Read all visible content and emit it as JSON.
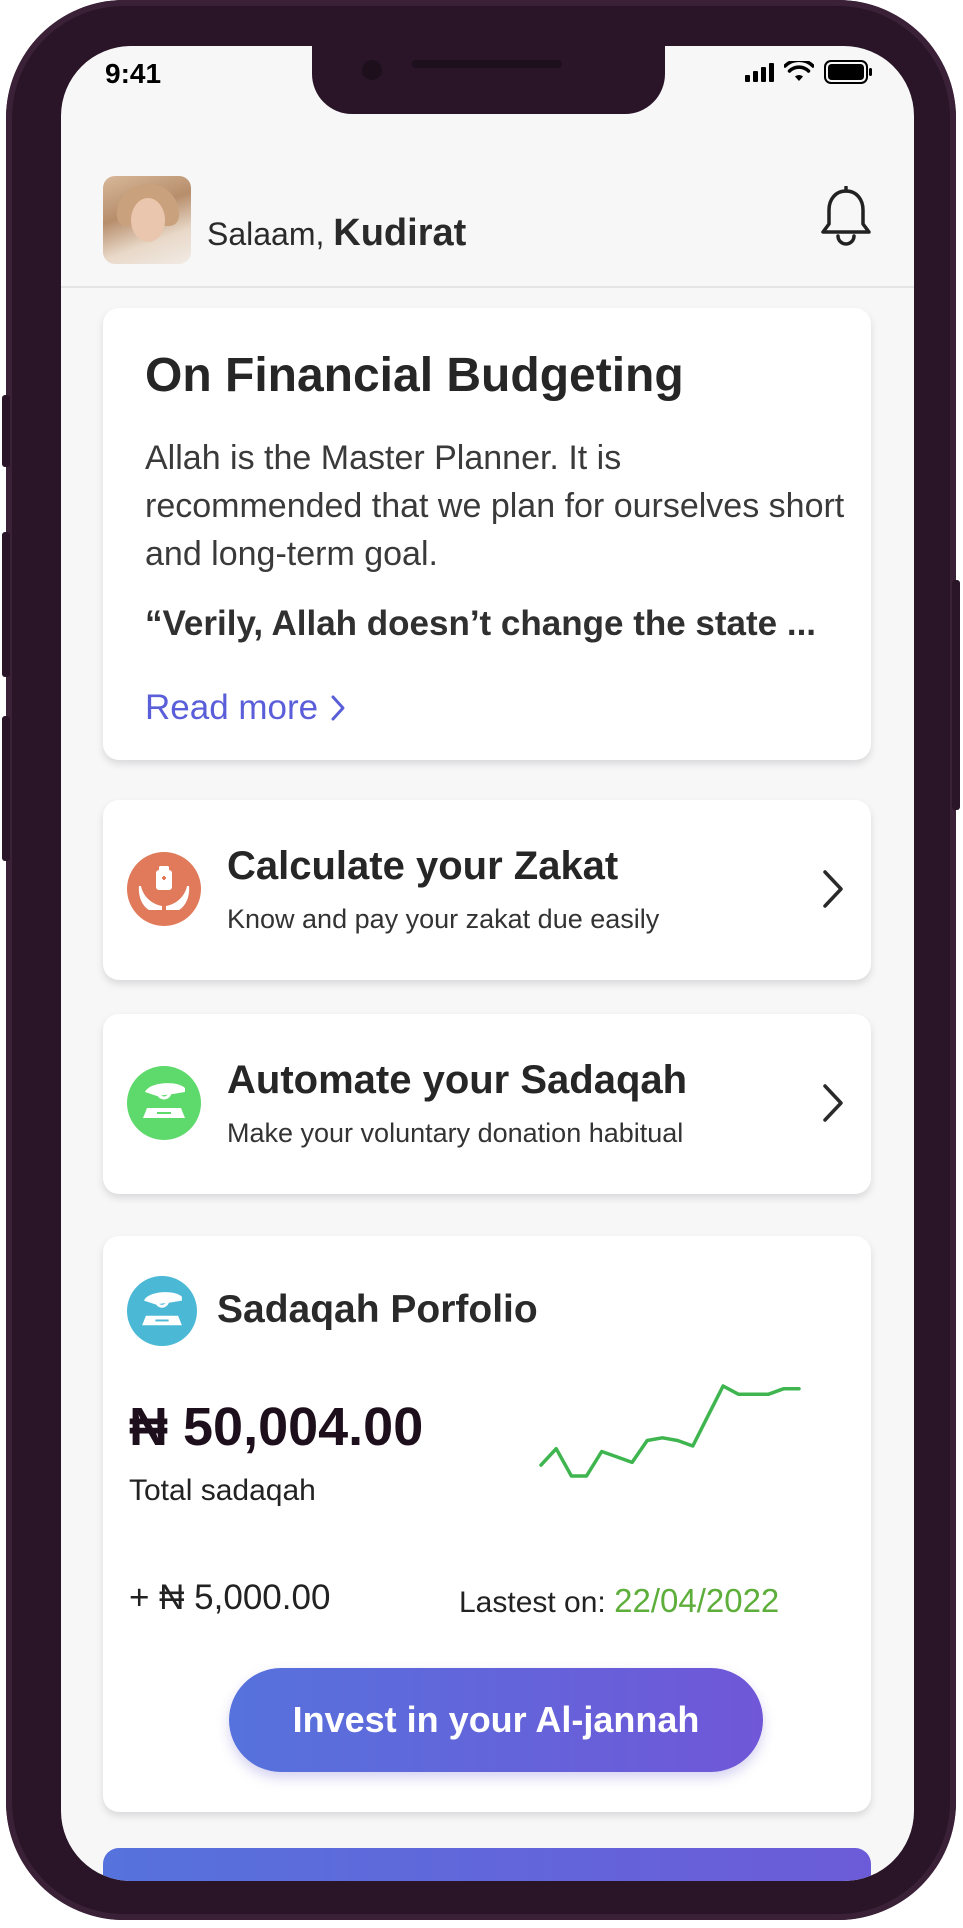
{
  "status_bar": {
    "time": "9:41"
  },
  "header": {
    "greeting": "Salaam,",
    "name": "Kudirat"
  },
  "budget_card": {
    "title": "On Financial Budgeting",
    "body": "Allah is the Master Planner. It is recommended that we plan for ourselves short and long-term goal.",
    "quote": "“Verily, Allah doesn’t change the state ...",
    "read_more": "Read more"
  },
  "actions": [
    {
      "title": "Calculate your Zakat",
      "subtitle": "Know and pay your zakat due easily",
      "icon": "zakat-hands-icon",
      "color": "#e07a5a"
    },
    {
      "title": "Automate your Sadaqah",
      "subtitle": "Make your voluntary donation habitual",
      "icon": "sadaqah-hand-icon",
      "color": "#5ed96b"
    }
  ],
  "portfolio": {
    "title": "Sadaqah Porfolio",
    "icon": "sadaqah-portfolio-icon",
    "icon_color": "#4bb9d6",
    "total_amount": "₦ 50,004.00",
    "total_label": "Total sadaqah",
    "change": "+ ₦ 5,000.00",
    "latest_label": "Lastest  on:",
    "latest_date": "22/04/2022",
    "trend_color": "#3fb54f",
    "trend_values": [
      12,
      18,
      8,
      8,
      17,
      15,
      13,
      21,
      22,
      21,
      19,
      30,
      41,
      38,
      38,
      38,
      40,
      40
    ]
  },
  "invest_button": "Invest in your Al-jannah",
  "colors": {
    "accent": "#5a5fd9",
    "device_frame": "#2a1528",
    "button_gradient_start": "#5672dc",
    "button_gradient_end": "#7057d8"
  }
}
